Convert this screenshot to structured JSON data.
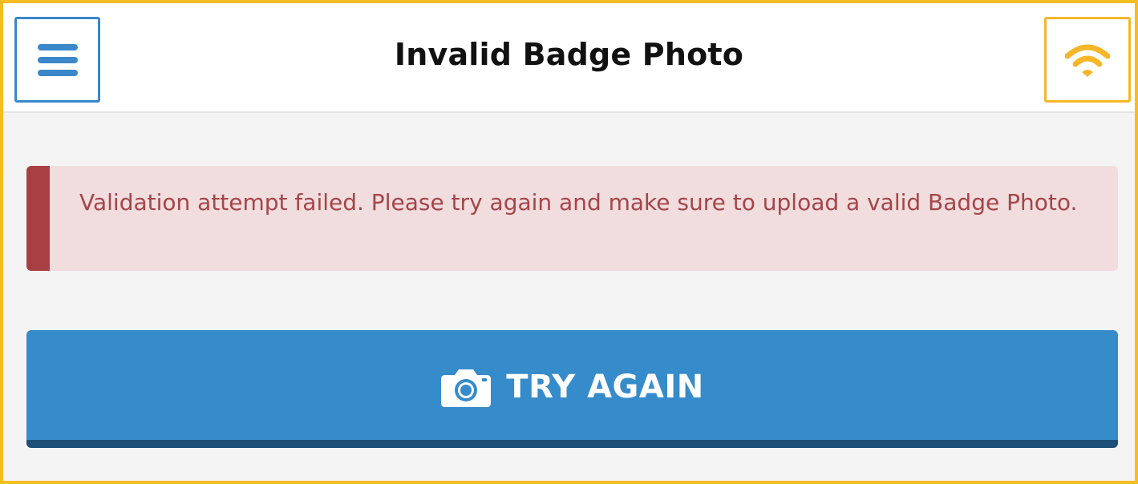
{
  "header": {
    "title": "Invalid Badge Photo",
    "menu_icon": "hamburger-menu-icon",
    "status_icon": "wifi-icon"
  },
  "alert": {
    "message": "Validation attempt failed. Please try again and make sure to upload a valid Badge Photo."
  },
  "action": {
    "label": "TRY AGAIN",
    "icon": "camera-icon"
  },
  "colors": {
    "accent_blue": "#368bcb",
    "wifi_yellow": "#f6b628",
    "frame_yellow": "#f5bd1f",
    "alert_red": "#a84043",
    "alert_bg": "#f1dcde"
  }
}
